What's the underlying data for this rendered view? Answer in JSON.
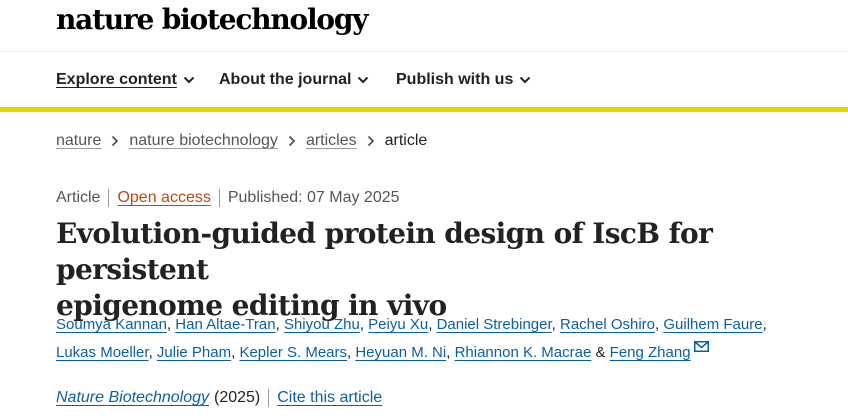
{
  "header": {
    "logo": "nature biotechnology"
  },
  "nav": {
    "items": [
      {
        "label": "Explore content"
      },
      {
        "label": "About the journal"
      },
      {
        "label": "Publish with us"
      }
    ]
  },
  "breadcrumb": [
    "nature",
    "nature biotechnology",
    "articles",
    "article"
  ],
  "article": {
    "type": "Article",
    "open_access": "Open access",
    "published": "Published: 07 May 2025",
    "title_line1": "Evolution-guided protein design of IscB for persistent",
    "title_line2": "epigenome editing in vivo",
    "authors": [
      "Soumya Kannan",
      "Han Altae-Tran",
      "Shiyou Zhu",
      "Peiyu Xu",
      "Daniel Strebinger",
      "Rachel Oshiro",
      "Guilhem Faure",
      "Lukas Moeller",
      "Julie Pham",
      "Kepler S. Mears",
      "Heyuan M. Ni",
      "Rhiannon K. Macrae",
      "Feng Zhang"
    ],
    "journal": "Nature Biotechnology",
    "year": "(2025)",
    "cite_label": "Cite this article"
  },
  "colors": {
    "accent_bar": "#e6d600",
    "link": "#0c5fa5",
    "open_access": "#b64a14"
  }
}
